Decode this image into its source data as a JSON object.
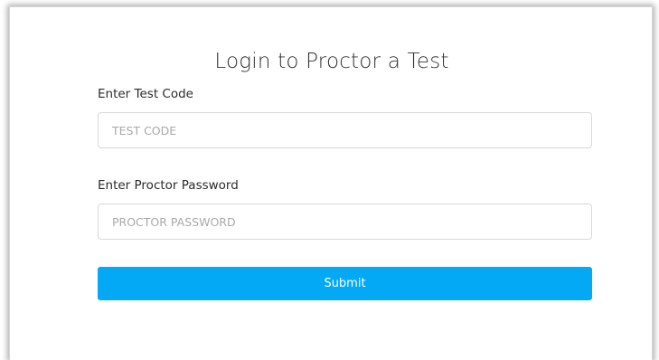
{
  "form": {
    "title": "Login to Proctor a Test",
    "test_code": {
      "label": "Enter Test Code",
      "placeholder": "TEST CODE",
      "value": ""
    },
    "proctor_password": {
      "label": "Enter Proctor Password",
      "placeholder": "PROCTOR PASSWORD",
      "value": ""
    },
    "submit_label": "Submit"
  },
  "colors": {
    "accent": "#04a9f5",
    "background": "#ffffff",
    "input_border": "#d9d9d9",
    "placeholder": "#a9a9a9"
  }
}
